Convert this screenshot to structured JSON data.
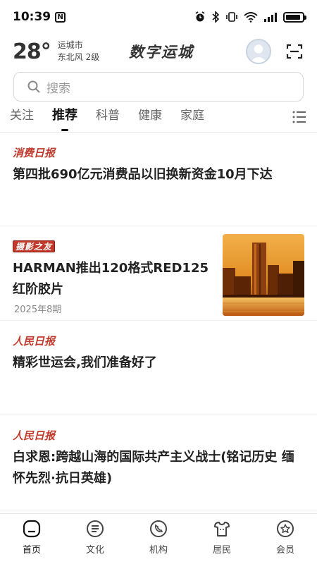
{
  "status_bar": {
    "time": "10:39",
    "nfc_label": "N",
    "battery_level": 0.9
  },
  "header": {
    "temperature": "28°",
    "city": "运城市",
    "wind": "东北风  2级",
    "app_title": "数字运城"
  },
  "search": {
    "placeholder": "搜索"
  },
  "tabs": [
    {
      "label": "关注"
    },
    {
      "label": "推荐",
      "active": true
    },
    {
      "label": "科普"
    },
    {
      "label": "健康"
    },
    {
      "label": "家庭"
    }
  ],
  "feed": {
    "items": [
      {
        "source": "消费日报",
        "title": "第四批690亿元消费品以旧换新资金10月下达"
      },
      {
        "source": "摄影之友",
        "title": "HARMAN推出120格式RED125红阶胶片",
        "issue": "2025年8期"
      },
      {
        "source": "人民日报",
        "title": "精彩世运会,我们准备好了"
      },
      {
        "source": "人民日报",
        "title": "白求恩:跨越山海的国际共产主义战士(铭记历史 缅怀先烈·抗日英雄)"
      }
    ]
  },
  "bottom_nav": [
    {
      "label": "首页",
      "icon": "home-icon",
      "active": true
    },
    {
      "label": "文化",
      "icon": "culture-icon"
    },
    {
      "label": "机构",
      "icon": "phone-icon"
    },
    {
      "label": "居民",
      "icon": "resident-icon"
    },
    {
      "label": "会员",
      "icon": "member-icon"
    }
  ],
  "colors": {
    "accent_red": "#c0392b",
    "text_dark": "#222222"
  }
}
